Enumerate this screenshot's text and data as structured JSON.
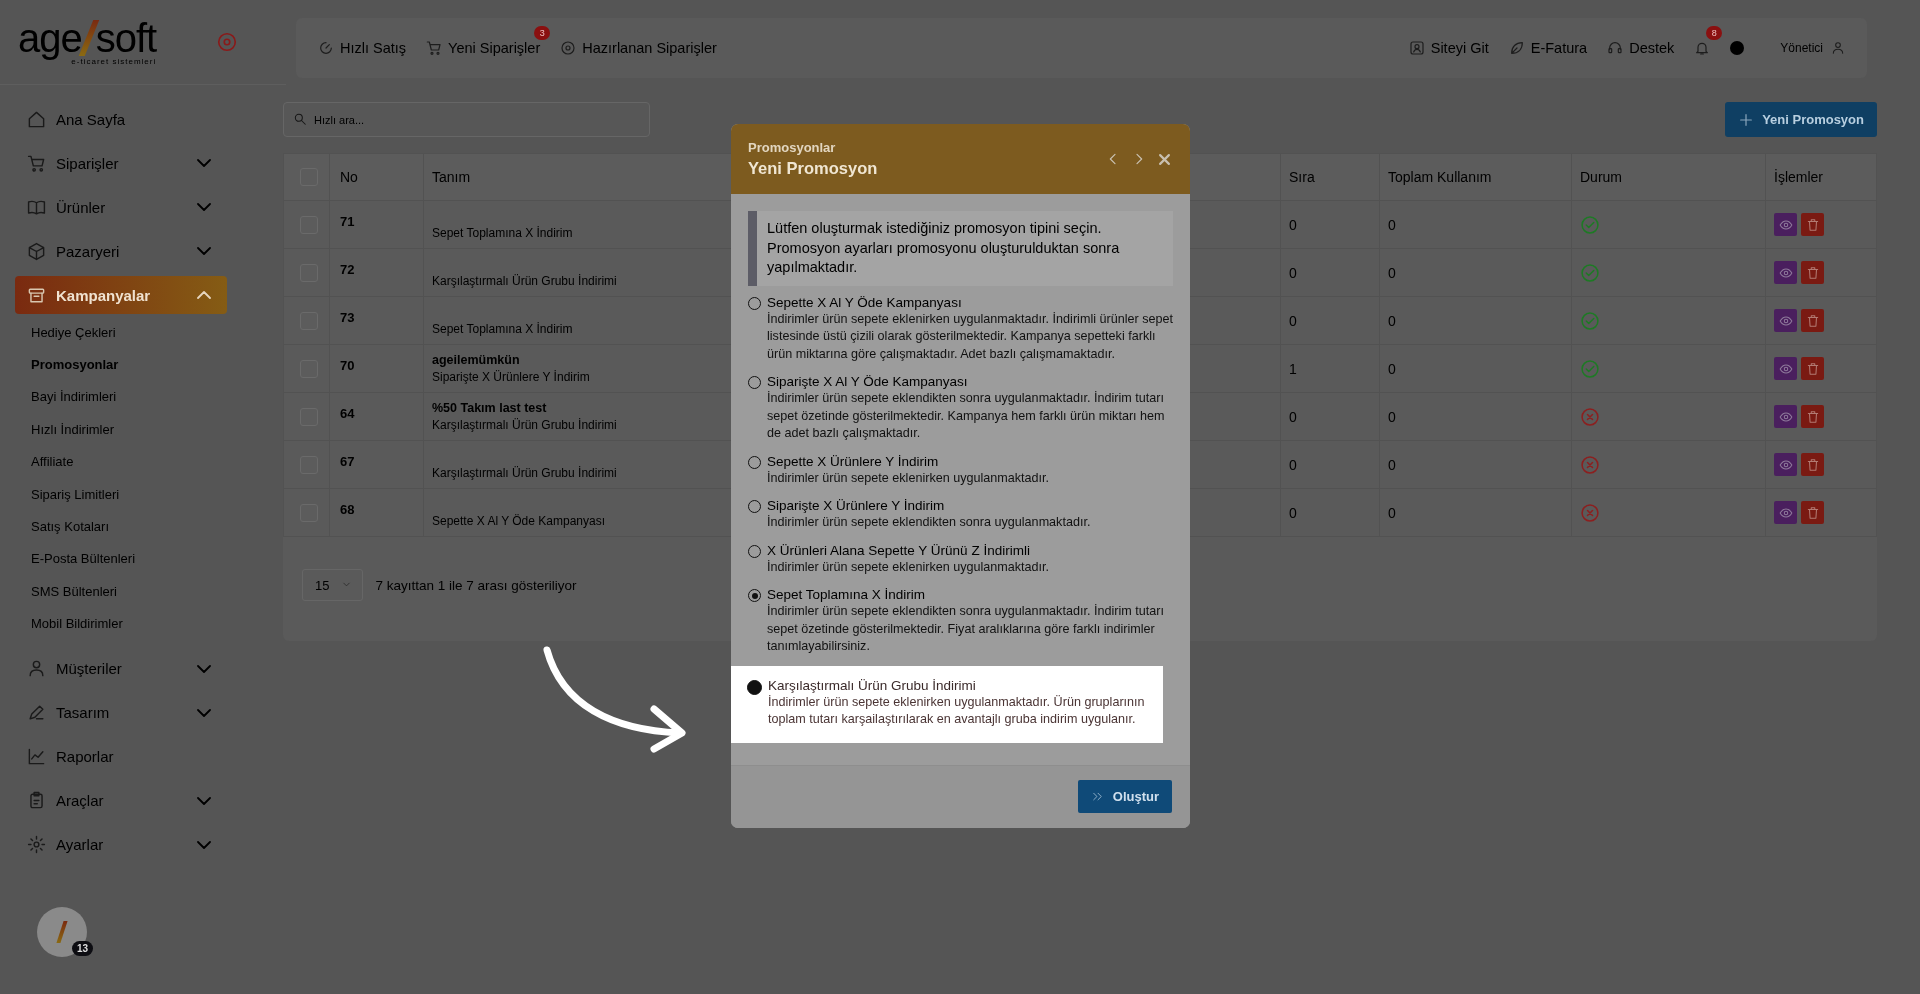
{
  "logo": {
    "brand_left": "age",
    "brand_right": "soft",
    "tagline": "e-ticaret sistemleri"
  },
  "sidebar": {
    "items": [
      {
        "label": "Ana Sayfa",
        "expandable": false,
        "selected": false
      },
      {
        "label": "Siparişler",
        "expandable": true,
        "expanded": false,
        "selected": false
      },
      {
        "label": "Ürünler",
        "expandable": true,
        "expanded": false,
        "selected": false
      },
      {
        "label": "Pazaryeri",
        "expandable": true,
        "expanded": false,
        "selected": false
      },
      {
        "label": "Kampanyalar",
        "expandable": true,
        "expanded": true,
        "selected": true,
        "children": [
          {
            "label": "Hediye Çekleri",
            "selected": false
          },
          {
            "label": "Promosyonlar",
            "selected": true
          },
          {
            "label": "Bayi İndirimleri",
            "selected": false
          },
          {
            "label": "Hızlı İndirimler",
            "selected": false
          },
          {
            "label": "Affiliate",
            "selected": false
          },
          {
            "label": "Sipariş Limitleri",
            "selected": false
          },
          {
            "label": "Satış Kotaları",
            "selected": false
          },
          {
            "label": "E-Posta Bültenleri",
            "selected": false
          },
          {
            "label": "SMS Bültenleri",
            "selected": false
          },
          {
            "label": "Mobil Bildirimler",
            "selected": false
          }
        ]
      },
      {
        "label": "Müşteriler",
        "expandable": true,
        "expanded": false,
        "selected": false
      },
      {
        "label": "Tasarım",
        "expandable": true,
        "expanded": false,
        "selected": false
      },
      {
        "label": "Raporlar",
        "expandable": false,
        "selected": false
      },
      {
        "label": "Araçlar",
        "expandable": true,
        "expanded": false,
        "selected": false
      },
      {
        "label": "Ayarlar",
        "expandable": true,
        "expanded": false,
        "selected": false
      }
    ]
  },
  "topbar": {
    "left": [
      {
        "label": "Hızlı Satış"
      },
      {
        "label": "Yeni Siparişler",
        "badge": "3"
      },
      {
        "label": "Hazırlanan Siparişler"
      }
    ],
    "right": [
      {
        "label": "Siteyi Git"
      },
      {
        "label": "E-Fatura"
      },
      {
        "label": "Destek"
      }
    ],
    "notifications_badge": "8",
    "user": "Yönetici"
  },
  "search": {
    "placeholder": "Hızlı ara..."
  },
  "new_button": "Yeni Promosyon",
  "table": {
    "select_all_checked": false,
    "columns": [
      "No",
      "Tanım",
      "Sıra",
      "Toplam Kullanım",
      "Durum",
      "İşlemler"
    ],
    "rows": [
      {
        "checked": false,
        "no": "71",
        "type": "Sepet Toplamına X İndirim",
        "order": "0",
        "usage": "0",
        "active": true
      },
      {
        "checked": false,
        "no": "72",
        "type": "Karşılaştırmalı Ürün Grubu İndirimi",
        "order": "0",
        "usage": "0",
        "active": true
      },
      {
        "checked": false,
        "no": "73",
        "type": "Sepet Toplamına X İndirim",
        "order": "0",
        "usage": "0",
        "active": true
      },
      {
        "checked": false,
        "no": "70",
        "title": "ageilemümkün",
        "type": "Siparişte X Ürünlere Y İndirim",
        "order": "1",
        "usage": "0",
        "active": true
      },
      {
        "checked": false,
        "no": "64",
        "title": "%50 Takım last test",
        "type": "Karşılaştırmalı Ürün Grubu İndirimi",
        "order": "0",
        "usage": "0",
        "active": false
      },
      {
        "checked": false,
        "no": "67",
        "type": "Karşılaştırmalı Ürün Grubu İndirimi",
        "order": "0",
        "usage": "0",
        "active": false
      },
      {
        "checked": false,
        "no": "68",
        "type": "Sepette X Al Y Öde Kampanyası",
        "order": "0",
        "usage": "0",
        "active": false
      }
    ],
    "page_size": "15",
    "summary": "7 kayıttan 1 ile 7 arası gösteriliyor"
  },
  "modal": {
    "breadcrumb": "Promosyonlar",
    "title": "Yeni Promosyon",
    "info": "Lütfen oluşturmak istediğiniz promosyon tipini seçin. Promosyon ayarları promosyonu oluşturulduktan sonra yapılmaktadır.",
    "options": [
      {
        "title": "Sepette X Al Y Öde Kampanyası",
        "description": "İndirimler ürün sepete eklenirken uygulanmaktadır. İndirimli ürünler sepet listesinde üstü çizili olarak gösterilmektedir. Kampanya sepetteki farklı ürün miktarına göre çalışmaktadır. Adet bazlı çalışmamaktadır.",
        "selected": false,
        "highlighted": false
      },
      {
        "title": "Siparişte X Al Y Öde Kampanyası",
        "description": "İndirimler ürün sepete eklendikten sonra uygulanmaktadır. İndirim tutarı sepet özetinde gösterilmektedir. Kampanya hem farklı ürün miktarı hem de adet bazlı çalışmaktadır.",
        "selected": false,
        "highlighted": false
      },
      {
        "title": "Sepette X Ürünlere Y İndirim",
        "description": "İndirimler ürün sepete eklenirken uygulanmaktadır.",
        "selected": false,
        "highlighted": false
      },
      {
        "title": "Siparişte X Ürünlere Y İndirim",
        "description": "İndirimler ürün sepete eklendikten sonra uygulanmaktadır.",
        "selected": false,
        "highlighted": false
      },
      {
        "title": "X Ürünleri Alana Sepette Y Ürünü Z İndirimli",
        "description": "İndirimler ürün sepete eklenirken uygulanmaktadır.",
        "selected": false,
        "highlighted": false
      },
      {
        "title": "Sepet Toplamına X İndirim",
        "description": "İndirimler ürün sepete eklendikten sonra uygulanmaktadır. İndirim tutarı sepet özetinde gösterilmektedir. Fiyat aralıklarına göre farklı indirimler tanımlayabilirsiniz.",
        "selected": true,
        "highlighted": false
      },
      {
        "title": "Karşılaştırmalı Ürün Grubu İndirimi",
        "description": "İndirimler ürün sepete eklenirken uygulanmaktadır. Ürün gruplarının toplam tutarı karşailaştırılarak en avantajlı gruba indirim uygulanır.",
        "selected": false,
        "highlighted": true
      }
    ],
    "submit": "Oluştur"
  },
  "floating_badge": "13"
}
